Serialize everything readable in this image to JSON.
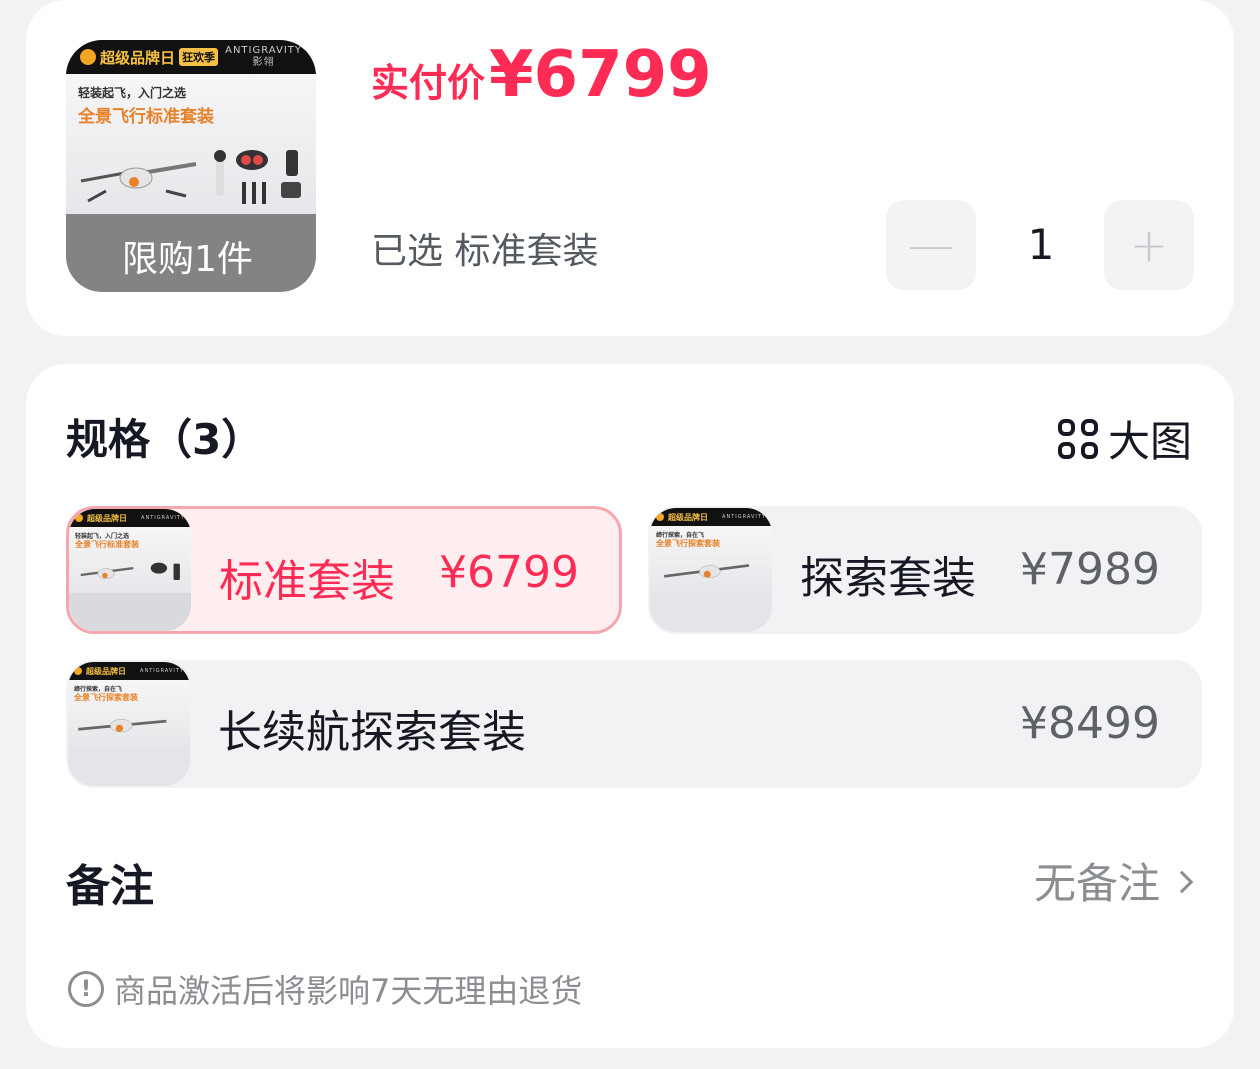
{
  "product": {
    "thumb": {
      "brand_text": "超级品牌日",
      "brand_tag": "狂欢季",
      "brand_right": "ANTIGRAVITY",
      "brand_right_sub": "影翎",
      "subtitle": "轻装起飞，入门之选",
      "title": "全景飞行标准套装",
      "badge": "限购1件"
    },
    "price_label": "实付价",
    "price_value": "¥6799",
    "selected_text": "已选 标准套装",
    "quantity": "1",
    "minus_symbol": "—",
    "plus_symbol": "+"
  },
  "specs": {
    "title": "规格（3）",
    "view_big": "大图",
    "options": [
      {
        "name": "标准套装",
        "price": "¥6799",
        "thumb_subtitle": "轻装起飞，入门之选",
        "thumb_title": "全景飞行标准套装",
        "selected": true
      },
      {
        "name": "探索套装",
        "price": "¥7989",
        "thumb_subtitle": "缔行探索，自在飞",
        "thumb_title": "全景飞行探索套装",
        "selected": false
      },
      {
        "name": "长续航探索套装",
        "price": "¥8499",
        "thumb_subtitle": "缔行探索，自在飞",
        "thumb_title": "全景飞行探索套装",
        "selected": false
      }
    ]
  },
  "remark": {
    "label": "备注",
    "value": "无备注"
  },
  "notice": {
    "icon": "!",
    "text": "商品激活后将影响7天无理由退货"
  },
  "colors": {
    "accent": "#fe2c55",
    "selected_bg": "#ffeef0",
    "thumb_title": "#e8822a"
  }
}
